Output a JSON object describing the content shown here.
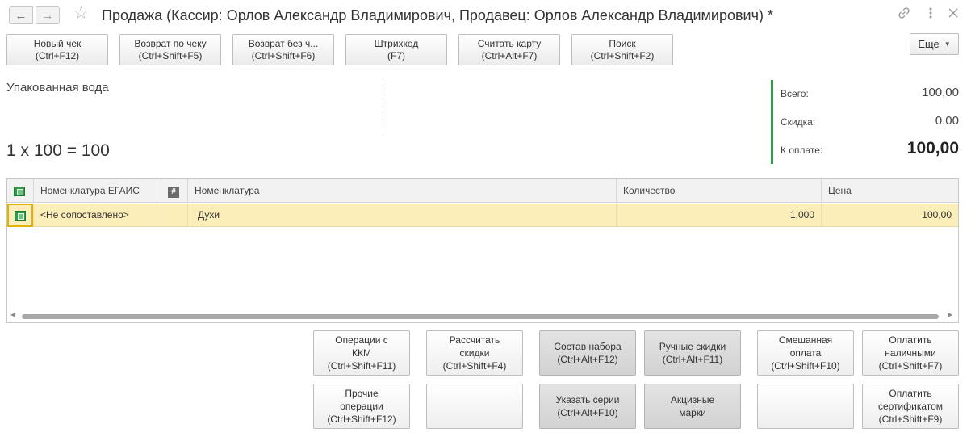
{
  "window": {
    "title": "Продажа (Кассир: Орлов Александр Владимирович, Продавец: Орлов Александр Владимирович) *",
    "icons": [
      "back-arrow-icon",
      "forward-arrow-icon",
      "star-icon",
      "link-icon",
      "more-vertical-icon",
      "close-icon"
    ]
  },
  "toolbar": {
    "buttons": [
      {
        "line1": "Новый чек",
        "line2": "(Ctrl+F12)"
      },
      {
        "line1": "Возврат по чеку",
        "line2": "(Ctrl+Shift+F5)"
      },
      {
        "line1": "Возврат без ч...",
        "line2": "(Ctrl+Shift+F6)"
      },
      {
        "line1": "Штрихкод",
        "line2": "(F7)"
      },
      {
        "line1": "Считать карту",
        "line2": "(Ctrl+Alt+F7)"
      },
      {
        "line1": "Поиск",
        "line2": "(Ctrl+Shift+F2)"
      }
    ],
    "more_label": "Еще"
  },
  "product": {
    "name": "Упакованная вода",
    "calc": "1 x 100 = 100"
  },
  "totals": {
    "total_label": "Всего:",
    "total_value": "100,00",
    "discount_label": "Скидка:",
    "discount_value": "0.00",
    "to_pay_label": "К оплате:",
    "to_pay_value": "100,00",
    "accent_color": "#2e9a46"
  },
  "table": {
    "columns": {
      "egais": "Номенклатура ЕГАИС",
      "hash": "#",
      "nomenclature": "Номенклатура",
      "quantity": "Количество",
      "price": "Цена"
    },
    "rows": [
      {
        "egais": "<Не сопоставлено>",
        "nomenclature": "Духи",
        "quantity": "1,000",
        "price": "100,00"
      }
    ],
    "selected_row_color": "#fbeeb8"
  },
  "actions": {
    "kkm_ops": {
      "line1": "Операции с",
      "line2": "ККМ",
      "line3": "(Ctrl+Shift+F11)"
    },
    "calc_discounts": {
      "line1": "Рассчитать",
      "line2": "скидки",
      "line3": "(Ctrl+Shift+F4)"
    },
    "kit": {
      "line1": "Состав набора",
      "line2": "(Ctrl+Alt+F12)"
    },
    "manual_discounts": {
      "line1": "Ручные скидки",
      "line2": "(Ctrl+Alt+F11)"
    },
    "mixed_payment": {
      "line1": "Смешанная",
      "line2": "оплата",
      "line3": "(Ctrl+Shift+F10)"
    },
    "pay_cash": {
      "line1": "Оплатить",
      "line2": "наличными",
      "line3": "(Ctrl+Shift+F7)"
    },
    "other_ops": {
      "line1": "Прочие",
      "line2": "операции",
      "line3": "(Ctrl+Shift+F12)"
    },
    "series": {
      "line1": "Указать серии",
      "line2": "(Ctrl+Alt+F10)"
    },
    "excise": {
      "line1": "Акцизные",
      "line2": "марки"
    },
    "pay_cert": {
      "line1": "Оплатить",
      "line2": "сертификатом",
      "line3": "(Ctrl+Shift+F9)"
    }
  }
}
